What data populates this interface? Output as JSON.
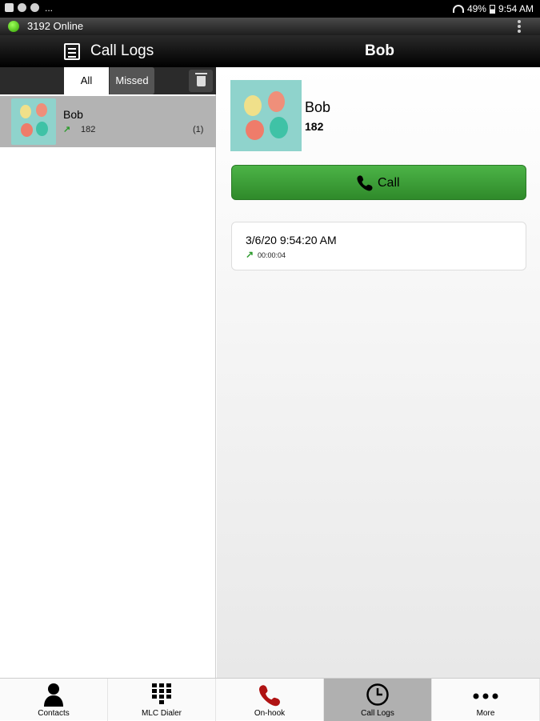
{
  "status_bar": {
    "overflow": "...",
    "battery": "49%",
    "time": "9:54 AM"
  },
  "account": {
    "status_text": "3192 Online",
    "status_color": "#3bbf1a"
  },
  "title_bar": {
    "left_title": "Call Logs",
    "right_title": "Bob"
  },
  "filter_tabs": {
    "all_label": "All",
    "missed_label": "Missed",
    "active": "All"
  },
  "call_log_list": [
    {
      "name": "Bob",
      "number": "182",
      "count": "(1)",
      "direction": "outgoing"
    }
  ],
  "detail": {
    "name": "Bob",
    "number": "182",
    "call_button_label": "Call",
    "call_button_color": "#3a9e35",
    "entries": [
      {
        "datetime": "3/6/20 9:54:20 AM",
        "duration": "00:00:04",
        "direction": "outgoing"
      }
    ]
  },
  "bottom_nav": [
    {
      "label": "Contacts",
      "icon": "person-icon"
    },
    {
      "label": "MLC Dialer",
      "icon": "dialpad-icon"
    },
    {
      "label": "On-hook",
      "icon": "phone-icon"
    },
    {
      "label": "Call Logs",
      "icon": "clock-icon",
      "active": true
    },
    {
      "label": "More",
      "icon": "more-dots-icon"
    }
  ],
  "icons": {
    "outgoing_arrow": "↗"
  }
}
